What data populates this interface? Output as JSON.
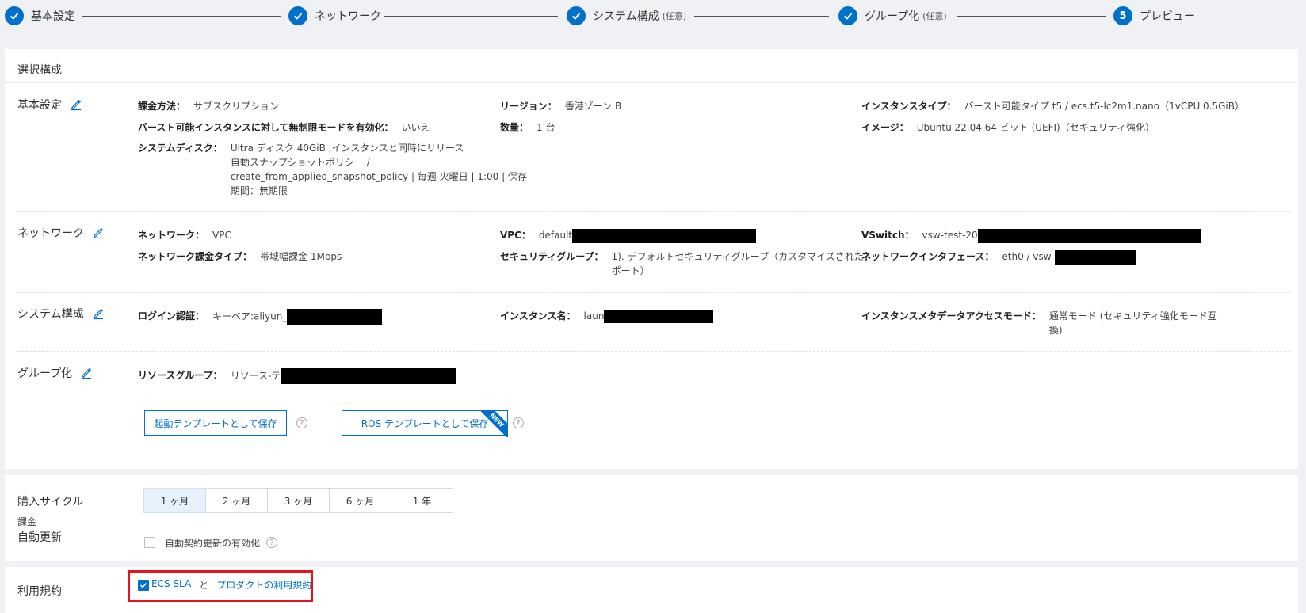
{
  "steps": [
    {
      "label": "基本設定",
      "optional": "",
      "state": "done"
    },
    {
      "label": "ネットワーク",
      "optional": "",
      "state": "done"
    },
    {
      "label": "システム構成",
      "optional": "(任意)",
      "state": "done"
    },
    {
      "label": "グループ化",
      "optional": "(任意)",
      "state": "done"
    },
    {
      "label": "プレビュー",
      "optional": "",
      "state": "current",
      "number": "5"
    }
  ],
  "summary": {
    "title": "選択構成",
    "basic": {
      "title": "基本設定",
      "billing_k": "課金方法：",
      "billing_v": "サブスクリプション",
      "burst_k": "バースト可能インスタンスに対して無制限モードを有効化：",
      "burst_v": "いいえ",
      "disk_k": "システムディスク：",
      "disk_lines": [
        "Ultra ディスク 40GiB ,インスタンスと同時にリリース",
        "自動スナップショットポリシー /",
        "create_from_applied_snapshot_policy | 毎週 火曜日 | 1:00 | 保存",
        "期間：無期限"
      ],
      "region_k": "リージョン：",
      "region_v": "香港ゾーン B",
      "qty_k": "数量：",
      "qty_v": "1 台",
      "itype_k": "インスタンスタイプ：",
      "itype_v": "バースト可能タイプ t5 / ecs.t5-lc2m1.nano（1vCPU 0.5GiB）",
      "image_k": "イメージ：",
      "image_v": "Ubuntu 22.04 64 ビット (UEFI)（セキュリティ強化）"
    },
    "network": {
      "title": "ネットワーク",
      "net_k": "ネットワーク：",
      "net_v": "VPC",
      "netbill_k": "ネットワーク課金タイプ：",
      "netbill_v": "帯域幅課金 1Mbps",
      "vpc_k": "VPC：",
      "vpc_v": "default",
      "sg_k": "セキュリティグループ：",
      "sg_lines": [
        "1). デフォルトセキュリティグループ（カスタマイズされた",
        "ポート）"
      ],
      "vsw_k": "VSwitch：",
      "vsw_v": "vsw-test-20",
      "nic_k": "ネットワークインタフェース：",
      "nic_v": "eth0 / vsw-"
    },
    "system": {
      "title": "システム構成",
      "login_k": "ログイン認証：",
      "login_v": "キーペア:aliyun_",
      "iname_k": "インスタンス名：",
      "iname_v": "laun",
      "meta_k": "インスタンスメタデータアクセスモード：",
      "meta_lines": [
        "通常モード (セキュリティ強化モード互",
        "換)"
      ]
    },
    "group": {
      "title": "グループ化",
      "rg_k": "リソースグループ：",
      "rg_v": "リソース-テ"
    },
    "buttons": {
      "save_launch_template": "起動テンプレートとして保存",
      "save_ros_template": "ROS テンプレートとして保存",
      "new_badge": "NEW",
      "help": "?"
    }
  },
  "purchase": {
    "cycle_label": "購入サイクル",
    "billing_label": "課金",
    "renew_label": "自動更新",
    "cycles": [
      "1 ヶ月",
      "2 ヶ月",
      "3 ヶ月",
      "6 ヶ月",
      "1 年"
    ],
    "selected_cycle": "1 ヶ月",
    "auto_renew_text": "自動契約更新の有効化",
    "auto_renew_checked": false
  },
  "terms": {
    "label": "利用規約",
    "sla_link": "ECS SLA",
    "and_text": "と",
    "product_terms_link": "プロダクトの利用規約",
    "checked": true
  },
  "colors": {
    "primary": "#0070cc",
    "highlight_box": "#e5141c",
    "background": "#f0f1f4"
  }
}
